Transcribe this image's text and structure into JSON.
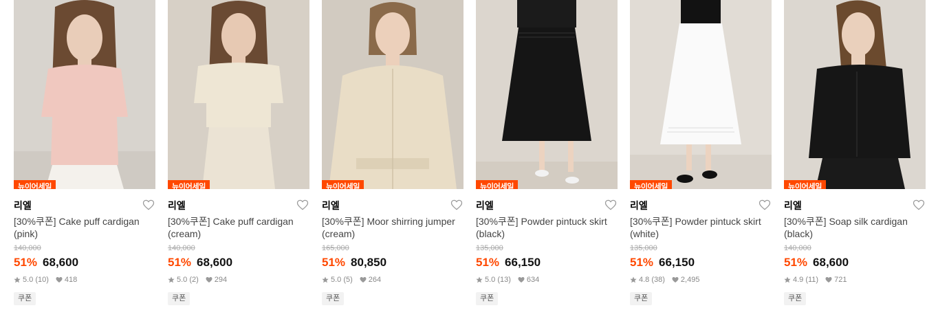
{
  "products": [
    {
      "badge": "뉴이어세일",
      "brand": "리엘",
      "title": "[30%쿠폰] Cake puff cardigan (pink)",
      "original_price": "140,000",
      "discount": "51%",
      "price": "68,600",
      "rating": "5.0 (10)",
      "likes": "418",
      "coupon": "쿠폰",
      "colors": {
        "bg": "#d8d4ce",
        "top": "#f0c8bf",
        "bottom": "#f4f1ec",
        "skin": "#e9cdb9",
        "hair": "#6b4a32"
      }
    },
    {
      "badge": "뉴이어세일",
      "brand": "리엘",
      "title": "[30%쿠폰] Cake puff cardigan (cream)",
      "original_price": "140,000",
      "discount": "51%",
      "price": "68,600",
      "rating": "5.0 (2)",
      "likes": "294",
      "coupon": "쿠폰",
      "colors": {
        "bg": "#d7d0c6",
        "top": "#eee6d4",
        "bottom": "#ebe3d4",
        "skin": "#e7c9b3",
        "hair": "#6a4a33"
      }
    },
    {
      "badge": "뉴이어세일",
      "brand": "리엘",
      "title": "[30%쿠폰] Moor shirring jumper (cream)",
      "original_price": "165,000",
      "discount": "51%",
      "price": "80,850",
      "rating": "5.0 (5)",
      "likes": "264",
      "coupon": "쿠폰",
      "colors": {
        "bg": "#d2cbc1",
        "top": "#e9ddc6",
        "bottom": "#e9ddc6",
        "skin": "#ecd0bb",
        "hair": "#8a6a4a"
      }
    },
    {
      "badge": "뉴이어세일",
      "brand": "리엘",
      "title": "[30%쿠폰] Powder pintuck skirt (black)",
      "original_price": "135,000",
      "discount": "51%",
      "price": "66,150",
      "rating": "5.0 (13)",
      "likes": "634",
      "coupon": "쿠폰",
      "colors": {
        "bg": "#dcd6ce",
        "top": "#1b1b1b",
        "bottom": "#151515",
        "skin": "#ecd3c0",
        "hair": "#3a2a20"
      }
    },
    {
      "badge": "뉴이어세일",
      "brand": "리엘",
      "title": "[30%쿠폰] Powder pintuck skirt (white)",
      "original_price": "135,000",
      "discount": "51%",
      "price": "66,150",
      "rating": "4.8 (38)",
      "likes": "2,495",
      "coupon": "쿠폰",
      "colors": {
        "bg": "#e1dcd5",
        "top": "#121212",
        "bottom": "#fafafa",
        "skin": "#ecd3c0",
        "hair": "#3a2a20"
      }
    },
    {
      "badge": "뉴이어세일",
      "brand": "리엘",
      "title": "[30%쿠폰] Soap silk cardigan (black)",
      "original_price": "140,000",
      "discount": "51%",
      "price": "68,600",
      "rating": "4.9 (11)",
      "likes": "721",
      "coupon": "쿠폰",
      "colors": {
        "bg": "#dcd7d0",
        "top": "#161616",
        "bottom": "#1a1a1a",
        "skin": "#ead0bc",
        "hair": "#6b4a2e"
      }
    }
  ],
  "accent_color": "#ff4800"
}
